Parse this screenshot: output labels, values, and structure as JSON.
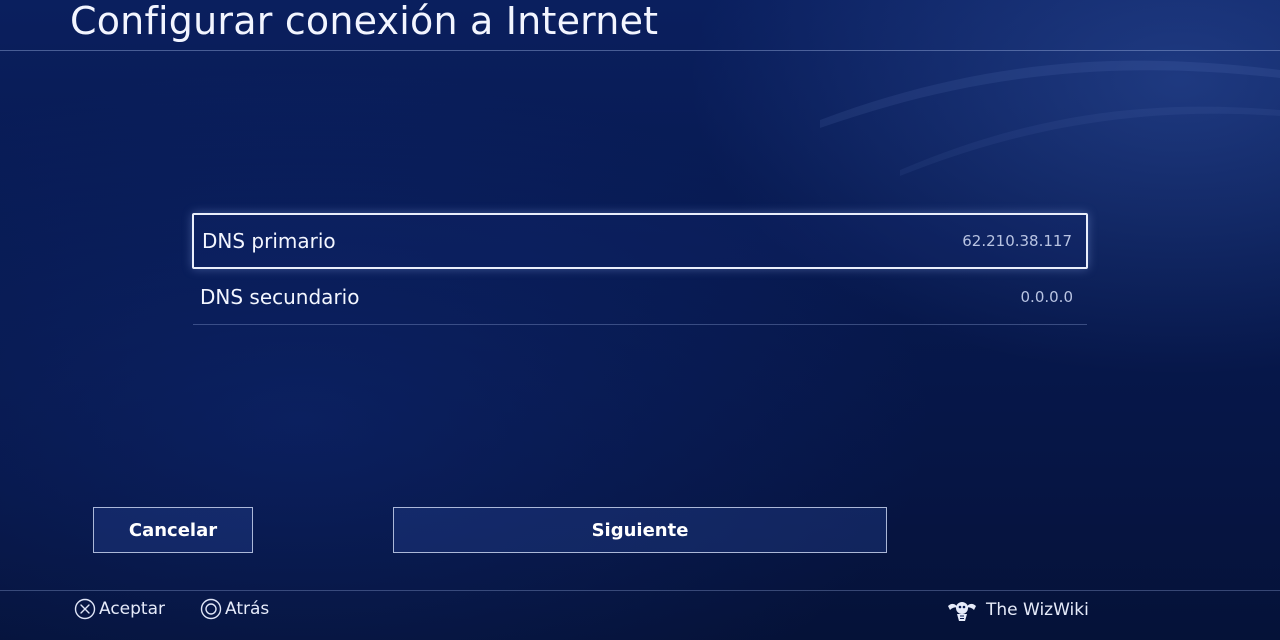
{
  "header": {
    "title": "Configurar conexión a Internet"
  },
  "dns": {
    "items": [
      {
        "label": "DNS primario",
        "value": "62.210.38.117"
      },
      {
        "label": "DNS secundario",
        "value": "0.0.0.0"
      }
    ]
  },
  "buttons": {
    "cancel_label": "Cancelar",
    "next_label": "Siguiente"
  },
  "footer": {
    "accept_label": "Aceptar",
    "back_label": "Atrás",
    "accept_icon": "cross-button-icon",
    "back_icon": "circle-button-icon"
  },
  "watermark": {
    "text": "The WizWiki",
    "icon": "wizwiki-logo-icon"
  },
  "colors": {
    "background": "#07194f",
    "focus_border": "#e9eefb",
    "text": "#ffffff"
  }
}
